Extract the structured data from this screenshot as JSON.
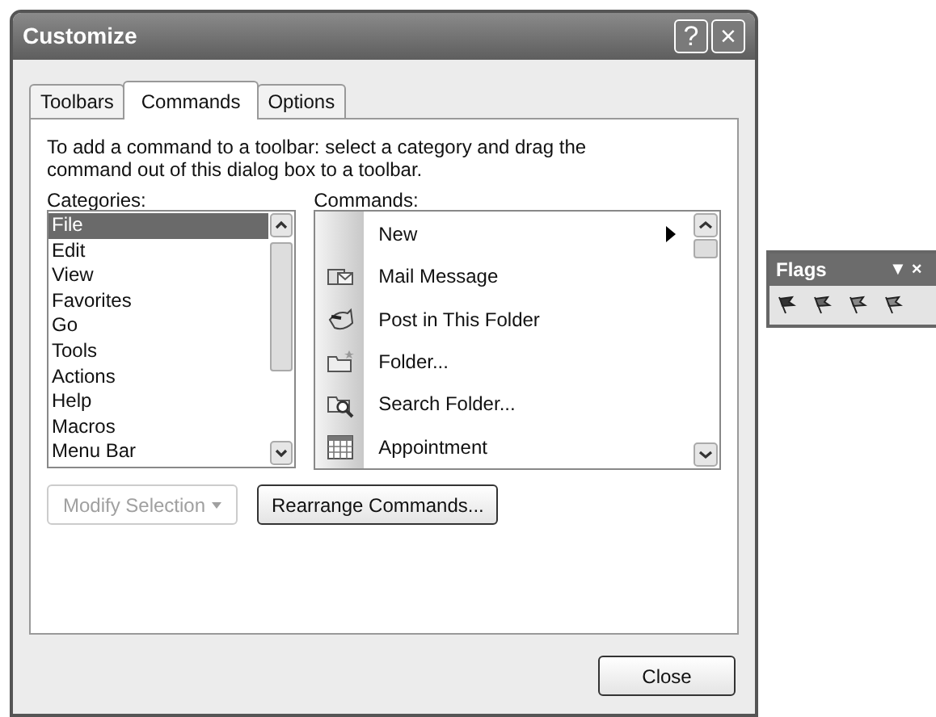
{
  "window": {
    "title": "Customize",
    "buttons": [
      "?",
      "×"
    ]
  },
  "tabs": [
    {
      "label": "Toolbars",
      "selected": false
    },
    {
      "label": "Commands",
      "selected": true
    },
    {
      "label": "Options",
      "selected": false
    }
  ],
  "instructions": "To add a command to a toolbar: select a category and drag the command out of this dialog box to a toolbar.",
  "categories": {
    "label": "Categories:",
    "items": [
      {
        "label": "File",
        "selected": true
      },
      {
        "label": "Edit",
        "selected": false
      },
      {
        "label": "View",
        "selected": false
      },
      {
        "label": "Favorites",
        "selected": false
      },
      {
        "label": "Go",
        "selected": false
      },
      {
        "label": "Tools",
        "selected": false
      },
      {
        "label": "Actions",
        "selected": false
      },
      {
        "label": "Help",
        "selected": false
      },
      {
        "label": "Macros",
        "selected": false
      },
      {
        "label": "Menu Bar",
        "selected": false
      }
    ]
  },
  "commands": {
    "label": "Commands:",
    "items": [
      {
        "label": "New",
        "kind": "none",
        "submenu": true
      },
      {
        "label": "Mail Message",
        "kind": "mail",
        "submenu": false
      },
      {
        "label": "Post in This Folder",
        "kind": "post",
        "submenu": false
      },
      {
        "label": "Folder...",
        "kind": "folder",
        "submenu": false
      },
      {
        "label": "Search Folder...",
        "kind": "search-folder",
        "submenu": false
      },
      {
        "label": "Appointment",
        "kind": "calendar",
        "submenu": false
      }
    ]
  },
  "modify_button": {
    "label": "Modify Selection",
    "disabled": true
  },
  "rearrange_button": {
    "label": "Rearrange Commands...",
    "disabled": false
  },
  "close_button": {
    "label": "Close"
  },
  "flags_toolbar": {
    "title": "Flags",
    "buttons": [
      "▼",
      "×"
    ],
    "tools": [
      {
        "kind": "flag"
      },
      {
        "kind": "flag"
      },
      {
        "kind": "flag"
      },
      {
        "kind": "flag"
      }
    ]
  }
}
